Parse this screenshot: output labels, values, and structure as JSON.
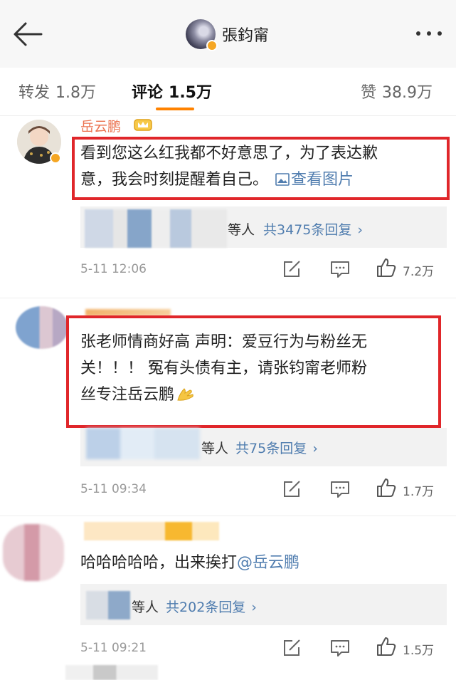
{
  "nav": {
    "title": "張鈞甯",
    "back_icon": "back-arrow-icon",
    "more_icon": "more-dots-icon"
  },
  "tabs": [
    {
      "label": "转发",
      "count": "1.8万"
    },
    {
      "label": "评论",
      "count": "1.5万"
    },
    {
      "label": "赞",
      "count": "38.9万"
    }
  ],
  "accent": "#ff8200",
  "highlight_color": "#e0262a",
  "link_color": "#507daf",
  "comments": [
    {
      "username": "岳云鹏",
      "text_line1": "看到您这么红我都不好意思了，为了表达歉",
      "text_line2": "意，我会时刻提醒着自己。",
      "image_link": "查看图片",
      "reply_suffix": "等人",
      "reply_count": "共3475条回复",
      "time": "5-11 12:06",
      "likes": "7.2万"
    },
    {
      "text_line1": "张老师情商好高 声明：爱豆行为与粉丝无",
      "text_line2": "关！！！ 冤有头债有主，请张钧甯老师粉",
      "text_line3": "丝专注岳云鹏",
      "reply_suffix": "等人",
      "reply_count": "共75条回复",
      "time": "5-11 09:34",
      "likes": "1.7万"
    },
    {
      "text": "哈哈哈哈哈，出来挨打",
      "mention": "@岳云鹏",
      "reply_suffix": "等人",
      "reply_count": "共202条回复",
      "time": "5-11 09:21",
      "likes": "1.5万"
    }
  ],
  "chevron": "›"
}
